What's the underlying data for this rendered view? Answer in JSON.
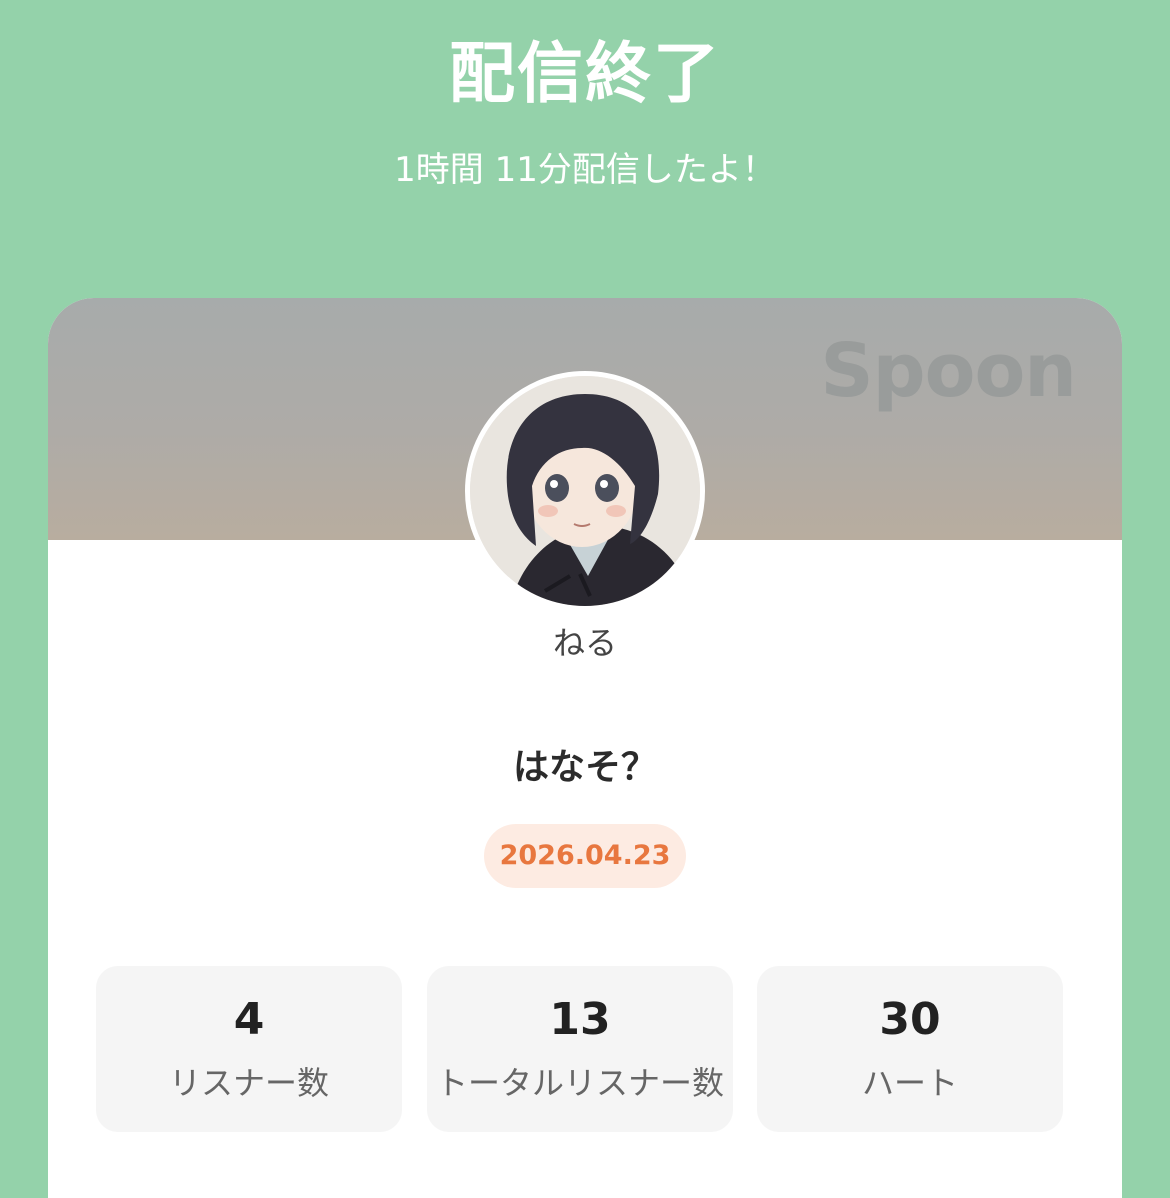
{
  "header": {
    "title": "配信終了",
    "subtitle": "1時間 11分配信したよ！"
  },
  "card": {
    "watermark": "Spoon",
    "username": "ねる",
    "live_title": "はなそ？",
    "date": "2026.04.23"
  },
  "stats": [
    {
      "value": "4",
      "label": "リスナー数"
    },
    {
      "value": "13",
      "label": "トータルリスナー数"
    },
    {
      "value": "30",
      "label": "ハート"
    }
  ],
  "colors": {
    "background": "#94d2aa",
    "card": "#ffffff",
    "date_text": "#e8773f",
    "date_badge": "#fdebe2",
    "stat_box": "#f5f5f5"
  },
  "icons": {
    "avatar": "anime-girl-avatar"
  }
}
